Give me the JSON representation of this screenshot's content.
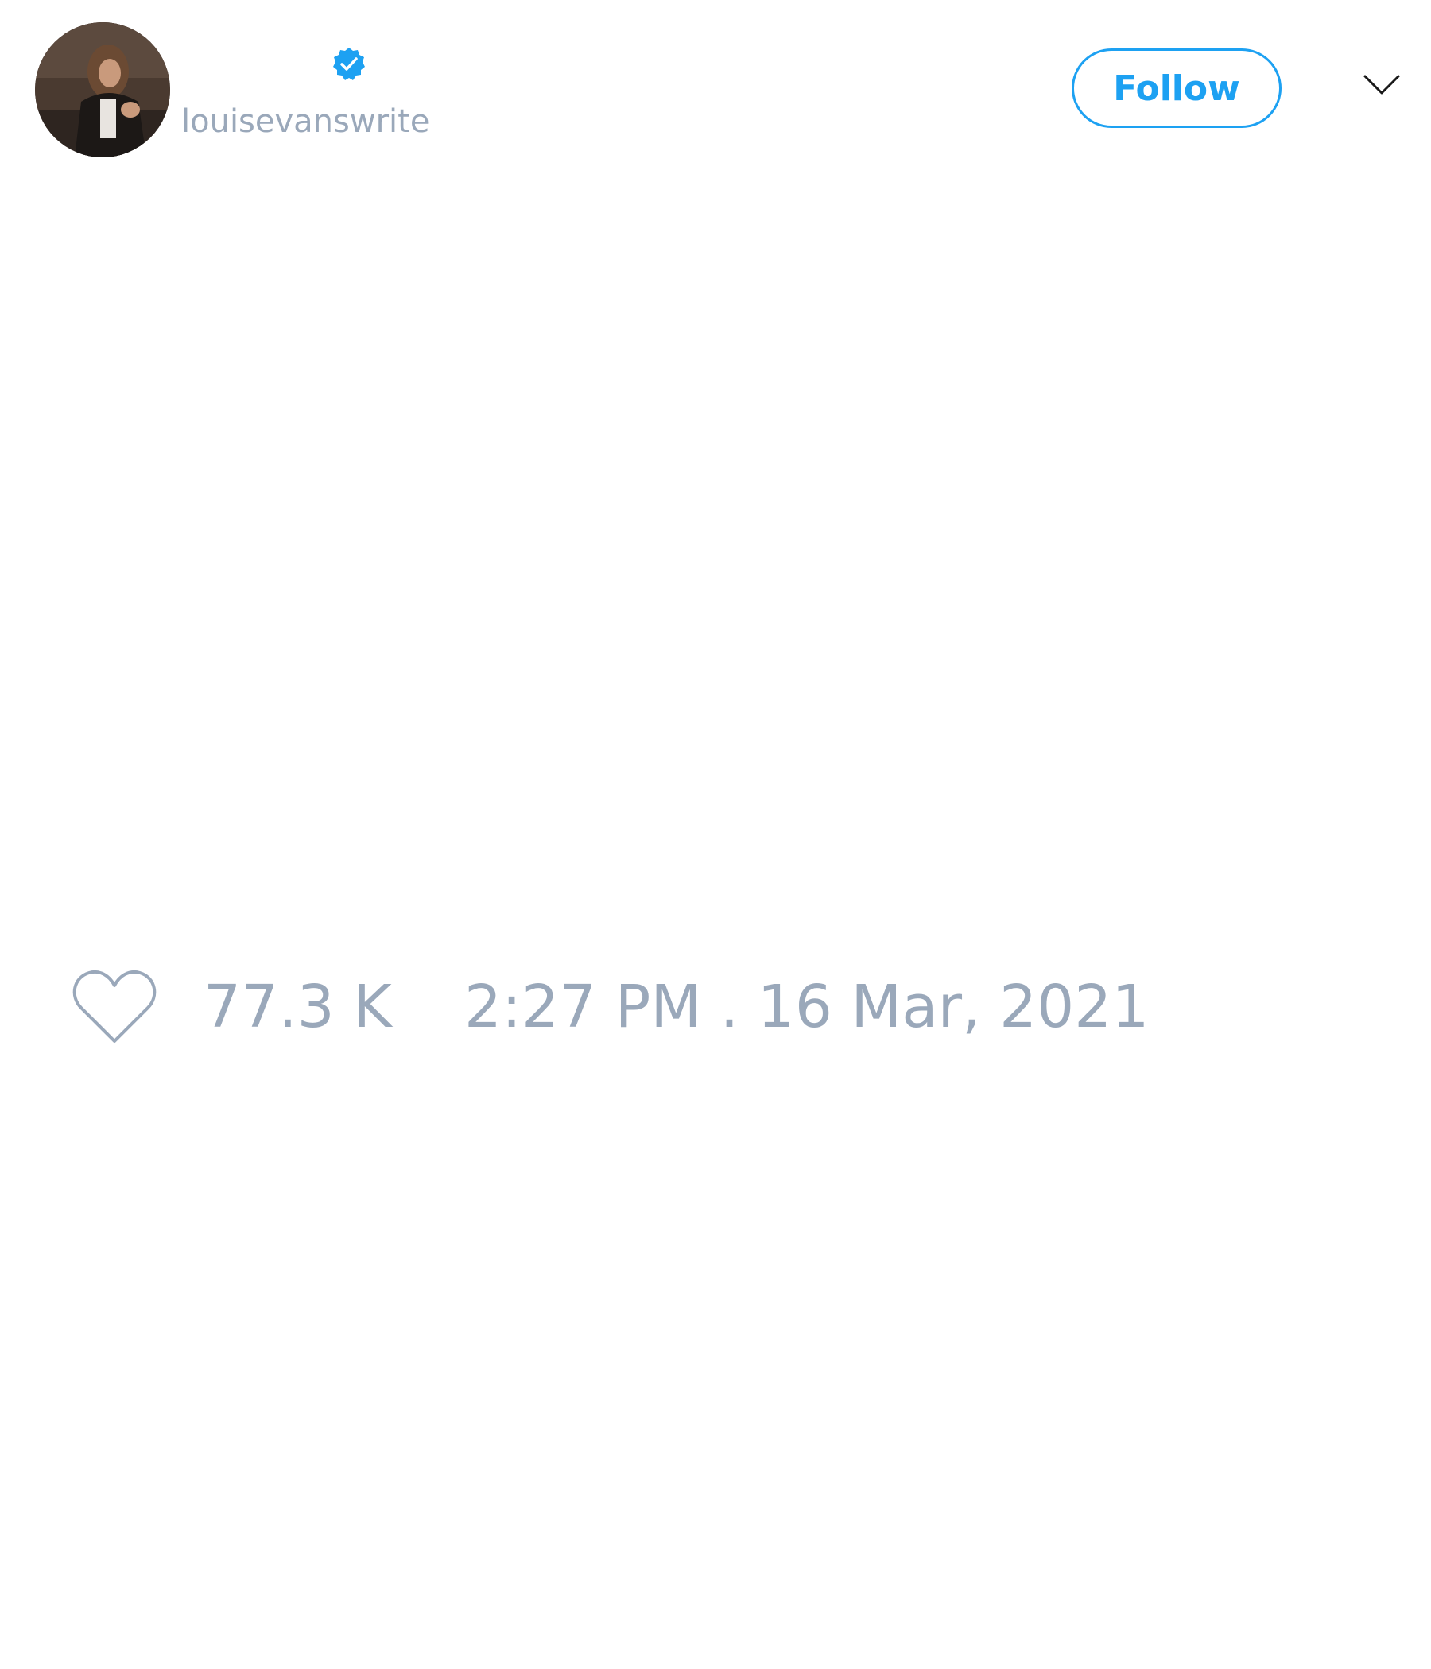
{
  "author": {
    "handle": "louisevanswrite",
    "verified": true
  },
  "actions": {
    "follow_label": "Follow"
  },
  "tweet": {
    "like_count": "77.3 K",
    "timestamp": "2:27 PM . 16 Mar, 2021"
  },
  "colors": {
    "accent": "#1da1f2",
    "muted_text": "#9aa8ba",
    "background": "#ffffff"
  },
  "icons": {
    "verified": "verified-badge-icon",
    "menu": "chevron-down-icon",
    "like": "heart-outline-icon"
  }
}
